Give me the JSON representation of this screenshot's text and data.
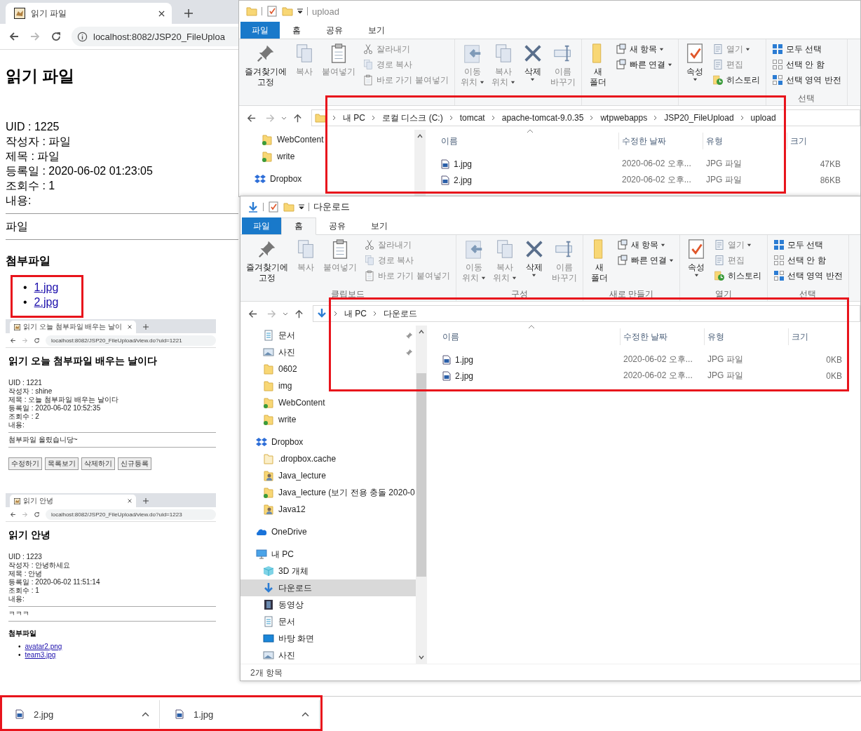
{
  "browser": {
    "tab_title": "읽기 파일",
    "url": "localhost:8082/JSP20_FileUploa",
    "page": {
      "heading": "읽기 파일",
      "fields": [
        "UID : 1225",
        "작성자 : 파일",
        "제목 : 파일",
        "등록일 : 2020-06-02 01:23:05",
        "조회수 : 1",
        "내용:"
      ],
      "content": "파일",
      "attach_heading": "첨부파일",
      "attachments": [
        {
          "bullet": "•",
          "name": "1.jpg"
        },
        {
          "bullet": "•",
          "name": "2.jpg"
        }
      ]
    },
    "screenshots": [
      {
        "tab_title": "읽기 오늘 첨부파일 배우는 날이",
        "url": "localhost:8082/JSP20_FileUpload/view.do?uid=1221",
        "heading": "읽기 오늘 첨부파일 배우는 날이다",
        "fields": [
          "UID : 1221",
          "작성자 : shine",
          "제목 : 오늘 첨부파일 배우는 날이다",
          "등록일 : 2020-06-02 10:52:35",
          "조회수 : 2",
          "내용:"
        ],
        "content": "첨부파일 올렸습니당~",
        "buttons": [
          "수정하기",
          "목록보기",
          "삭제하기",
          "신규등록"
        ]
      },
      {
        "tab_title": "읽기 안녕",
        "url": "localhost:8082/JSP20_FileUpload/view.do?uid=1223",
        "heading": "읽기 안녕",
        "fields": [
          "UID : 1223",
          "작성자 : 안녕하세요",
          "제목 : 안녕",
          "등록일 : 2020-06-02 11:51:14",
          "조회수 : 1",
          "내용:"
        ],
        "content": "ㅋㅋㅋ",
        "attach_heading": "첨부파일",
        "attachments": [
          {
            "bullet": "•",
            "name": "avatar2.png"
          },
          {
            "bullet": "•",
            "name": "team3.jpg"
          }
        ]
      }
    ]
  },
  "explorers": [
    {
      "title": {
        "text": "upload",
        "kind": "folder"
      },
      "tabs": [
        {
          "label": "파일",
          "kind": "file",
          "selected": false
        },
        {
          "label": "홈",
          "kind": "tab",
          "selected": false
        },
        {
          "label": "공유",
          "kind": "tab",
          "selected": false
        },
        {
          "label": "보기",
          "kind": "tab",
          "selected": false
        }
      ],
      "ribbon": [
        {
          "items": [
            {
              "kind": "pin",
              "lines": [
                "즐겨찾기에",
                "고정"
              ],
              "disabled": false,
              "dropdown": false
            },
            {
              "kind": "copy",
              "lines": [
                "복사"
              ],
              "disabled": true,
              "dropdown": false
            },
            {
              "kind": "paste",
              "lines": [
                "붙여넣기"
              ],
              "disabled": true,
              "dropdown": false
            },
            {
              "kind": "cut",
              "lines": [
                "잘라내기"
              ],
              "disabled": true,
              "dropdown": false
            },
            {
              "kind": "copy-path",
              "lines": [
                "경로 복사"
              ],
              "disabled": true,
              "dropdown": false
            },
            {
              "kind": "paste-shortcut",
              "lines": [
                "바로 가기 붙여넣기"
              ],
              "disabled": true,
              "dropdown": false
            }
          ]
        },
        {
          "items": [
            {
              "kind": "move",
              "lines": [
                "이동",
                "위치"
              ],
              "disabled": true,
              "dropdown": true
            },
            {
              "kind": "copy-to",
              "lines": [
                "복사",
                "위치"
              ],
              "disabled": true,
              "dropdown": true
            },
            {
              "kind": "delete",
              "lines": [
                "삭제"
              ],
              "disabled": false,
              "dropdown": true
            },
            {
              "kind": "rename",
              "lines": [
                "이름",
                "바꾸기"
              ],
              "disabled": true,
              "dropdown": false
            }
          ]
        },
        {
          "items": [
            {
              "kind": "new-folder",
              "lines": [
                "새",
                "폴더"
              ],
              "disabled": false,
              "dropdown": false
            },
            {
              "kind": "new-item",
              "lines": [
                "새 항목"
              ],
              "disabled": false,
              "dropdown": true
            },
            {
              "kind": "easy-access",
              "lines": [
                "빠른 연결"
              ],
              "disabled": false,
              "dropdown": true
            }
          ]
        },
        {
          "items": [
            {
              "kind": "properties",
              "lines": [
                "속성"
              ],
              "disabled": false,
              "dropdown": true
            },
            {
              "kind": "open",
              "lines": [
                "열기"
              ],
              "disabled": true,
              "dropdown": true
            },
            {
              "kind": "edit",
              "lines": [
                "편집"
              ],
              "disabled": true,
              "dropdown": false
            },
            {
              "kind": "history",
              "lines": [
                "히스토리"
              ],
              "disabled": false,
              "dropdown": false
            }
          ]
        },
        {
          "label": "선택",
          "items": [
            {
              "kind": "select-all",
              "lines": [
                "모두 선택"
              ],
              "disabled": false,
              "dropdown": false
            },
            {
              "kind": "select-none",
              "lines": [
                "선택 안 함"
              ],
              "disabled": false,
              "dropdown": false
            },
            {
              "kind": "invert",
              "lines": [
                "선택 영역 반전"
              ],
              "disabled": false,
              "dropdown": false
            }
          ]
        }
      ],
      "path": {
        "kind": "folder",
        "segments": [
          "내 PC",
          "로컬 디스크 (C:)",
          "tomcat",
          "apache-tomcat-9.0.35",
          "wtpwebapps",
          "JSP20_FileUpload",
          "upload"
        ]
      },
      "quick_access": [
        {
          "label": "WebContent",
          "kind": "folder-sync",
          "pinned": false,
          "selected": false
        },
        {
          "label": "write",
          "kind": "folder-sync",
          "pinned": false,
          "selected": false
        }
      ],
      "tree": [
        {
          "label": "Dropbox",
          "kind": "dropbox",
          "selected": false
        }
      ],
      "columns": [
        "이름",
        "수정한 날짜",
        "유형",
        "크기"
      ],
      "files": [
        {
          "name": "1.jpg",
          "date": "2020-06-02 오후...",
          "type": "JPG 파일",
          "size": "47KB"
        },
        {
          "name": "2.jpg",
          "date": "2020-06-02 오후...",
          "type": "JPG 파일",
          "size": "86KB"
        }
      ]
    },
    {
      "title": {
        "text": "다운로드",
        "kind": "download"
      },
      "tabs": [
        {
          "label": "파일",
          "kind": "file",
          "selected": false
        },
        {
          "label": "홈",
          "kind": "tab",
          "selected": true
        },
        {
          "label": "공유",
          "kind": "tab",
          "selected": false
        },
        {
          "label": "보기",
          "kind": "tab",
          "selected": false
        }
      ],
      "ribbon": [
        {
          "label": "클립보드",
          "items": [
            {
              "kind": "pin",
              "lines": [
                "즐겨찾기에",
                "고정"
              ],
              "disabled": false,
              "dropdown": false
            },
            {
              "kind": "copy",
              "lines": [
                "복사"
              ],
              "disabled": true,
              "dropdown": false
            },
            {
              "kind": "paste",
              "lines": [
                "붙여넣기"
              ],
              "disabled": true,
              "dropdown": false
            },
            {
              "kind": "cut",
              "lines": [
                "잘라내기"
              ],
              "disabled": true,
              "dropdown": false
            },
            {
              "kind": "copy-path",
              "lines": [
                "경로 복사"
              ],
              "disabled": true,
              "dropdown": false
            },
            {
              "kind": "paste-shortcut",
              "lines": [
                "바로 가기 붙여넣기"
              ],
              "disabled": true,
              "dropdown": false
            }
          ]
        },
        {
          "label": "구성",
          "items": [
            {
              "kind": "move",
              "lines": [
                "이동",
                "위치"
              ],
              "disabled": true,
              "dropdown": true
            },
            {
              "kind": "copy-to",
              "lines": [
                "복사",
                "위치"
              ],
              "disabled": true,
              "dropdown": true
            },
            {
              "kind": "delete",
              "lines": [
                "삭제"
              ],
              "disabled": false,
              "dropdown": true
            },
            {
              "kind": "rename",
              "lines": [
                "이름",
                "바꾸기"
              ],
              "disabled": true,
              "dropdown": false
            }
          ]
        },
        {
          "label": "새로 만들기",
          "items": [
            {
              "kind": "new-folder",
              "lines": [
                "새",
                "폴더"
              ],
              "disabled": false,
              "dropdown": false
            },
            {
              "kind": "new-item",
              "lines": [
                "새 항목"
              ],
              "disabled": false,
              "dropdown": true
            },
            {
              "kind": "easy-access",
              "lines": [
                "빠른 연결"
              ],
              "disabled": false,
              "dropdown": true
            }
          ]
        },
        {
          "label": "열기",
          "items": [
            {
              "kind": "properties",
              "lines": [
                "속성"
              ],
              "disabled": false,
              "dropdown": true
            },
            {
              "kind": "open",
              "lines": [
                "열기"
              ],
              "disabled": true,
              "dropdown": true
            },
            {
              "kind": "edit",
              "lines": [
                "편집"
              ],
              "disabled": true,
              "dropdown": false
            },
            {
              "kind": "history",
              "lines": [
                "히스토리"
              ],
              "disabled": false,
              "dropdown": false
            }
          ]
        },
        {
          "label": "선택",
          "items": [
            {
              "kind": "select-all",
              "lines": [
                "모두 선택"
              ],
              "disabled": false,
              "dropdown": false
            },
            {
              "kind": "select-none",
              "lines": [
                "선택 안 함"
              ],
              "disabled": false,
              "dropdown": false
            },
            {
              "kind": "invert",
              "lines": [
                "선택 영역 반전"
              ],
              "disabled": false,
              "dropdown": false
            }
          ]
        }
      ],
      "path": {
        "kind": "download",
        "segments": [
          "내 PC",
          "다운로드"
        ]
      },
      "quick_access": [
        {
          "label": "문서",
          "kind": "document",
          "pinned": true,
          "selected": false
        },
        {
          "label": "사진",
          "kind": "pictures",
          "pinned": true,
          "selected": false
        },
        {
          "label": "0602",
          "kind": "folder",
          "pinned": false,
          "selected": false
        },
        {
          "label": "img",
          "kind": "folder",
          "pinned": false,
          "selected": false
        },
        {
          "label": "WebContent",
          "kind": "folder-sync",
          "pinned": false,
          "selected": false
        },
        {
          "label": "write",
          "kind": "folder-sync",
          "pinned": false,
          "selected": false
        }
      ],
      "tree": [
        {
          "label": "Dropbox",
          "kind": "dropbox",
          "selected": false,
          "children": [
            {
              "label": ".dropbox.cache",
              "kind": "folder-faint",
              "selected": false
            },
            {
              "label": "Java_lecture",
              "kind": "folder-shared",
              "selected": false
            },
            {
              "label": "Java_lecture (보기 전용 충돌 2020-0",
              "kind": "folder-sync",
              "selected": false
            },
            {
              "label": "Java12",
              "kind": "folder-shared",
              "selected": false
            }
          ]
        },
        {
          "label": "OneDrive",
          "kind": "onedrive",
          "selected": false
        },
        {
          "label": "내 PC",
          "kind": "pc",
          "selected": false,
          "children": [
            {
              "label": "3D 개체",
              "kind": "cube",
              "selected": false
            },
            {
              "label": "다운로드",
              "kind": "download",
              "selected": true
            },
            {
              "label": "동영상",
              "kind": "video",
              "selected": false
            },
            {
              "label": "문서",
              "kind": "document",
              "selected": false
            },
            {
              "label": "바탕 화면",
              "kind": "desktop",
              "selected": false
            },
            {
              "label": "사진",
              "kind": "pictures",
              "selected": false
            }
          ]
        }
      ],
      "columns": [
        "이름",
        "수정한 날짜",
        "유형",
        "크기"
      ],
      "files": [
        {
          "name": "1.jpg",
          "date": "2020-06-02 오후...",
          "type": "JPG 파일",
          "size": "0KB"
        },
        {
          "name": "2.jpg",
          "date": "2020-06-02 오후...",
          "type": "JPG 파일",
          "size": "0KB"
        }
      ],
      "status": "2개 항목"
    }
  ],
  "downloads": [
    {
      "name": "2.jpg"
    },
    {
      "name": "1.jpg"
    }
  ]
}
